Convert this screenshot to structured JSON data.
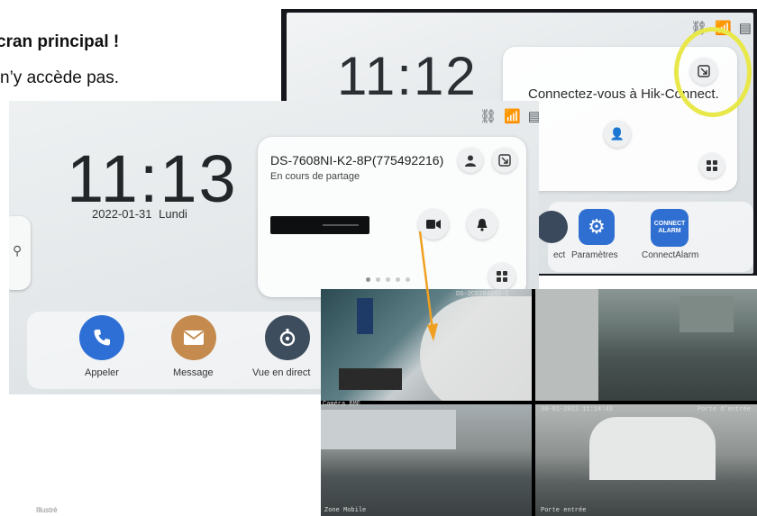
{
  "document": {
    "line1": "cran principal !",
    "line2": "n’y accède pas.",
    "footer": "Illustré"
  },
  "photo_top": {
    "time": "11:12",
    "connect_text": "Connectez-vous à Hik-Connect.",
    "status_icons": [
      "link-off-icon",
      "wifi-off-icon",
      "sd-card-icon"
    ],
    "apps": [
      {
        "label": "ect",
        "icon": "live-view-icon",
        "color": "#3a4a5c"
      },
      {
        "label": "Paramètres",
        "icon": "gear-icon",
        "color": "#2f6fd1"
      },
      {
        "label": "ConnectAlarm",
        "icon": "connect-alarm-icon",
        "color": "#2f6fd1",
        "badge": "CONNECT ALARM"
      }
    ],
    "highlight_color": "#e8e84a"
  },
  "photo_main": {
    "time": "11:13",
    "date": "2022-01-31",
    "weekday": "Lundi",
    "device_name": "DS-7608NI-K2-8P(775492216)",
    "device_status": "En cours de partage",
    "apps": [
      {
        "label": "Appeler",
        "icon": "phone-icon",
        "color": "#2e6fd6"
      },
      {
        "label": "Message",
        "icon": "envelope-icon",
        "color": "#c58a4e"
      },
      {
        "label": "Vue en direct",
        "icon": "live-view-icon",
        "color": "#3e4d5e"
      }
    ]
  },
  "cameras": {
    "cam1_label": "DS-2CD2046G2-I",
    "cam2_label": "",
    "cam3_label": "Caméra BMF",
    "cam3_time": "30-01-2022 11:14:43",
    "cam3_right": "Porte d'entrée",
    "cam3_bottom": "Zone Mobile",
    "cam4_bottom": "Porte entrée"
  },
  "colors": {
    "arrow": "#f0a020",
    "phone_blue": "#2e6fd6",
    "message_brown": "#c58a4e"
  }
}
